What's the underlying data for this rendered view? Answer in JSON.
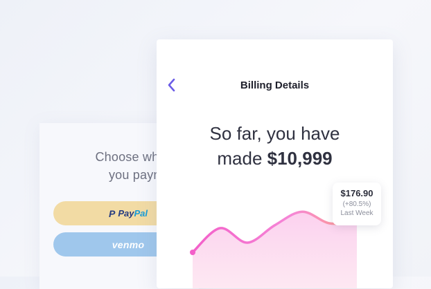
{
  "payment_card": {
    "headline_line1": "Choose where to",
    "headline_line2": "you paymen",
    "options": [
      {
        "pp_mark": "P",
        "pay": "Pay",
        "pal": "Pal",
        "color": "#f2dba4"
      },
      {
        "label": "venmo",
        "color": "#9fc7ec"
      }
    ]
  },
  "billing": {
    "back_icon": "chevron-left-icon",
    "title": "Billing Details",
    "summary_line1": "So far, you have",
    "summary_prefix": "made",
    "summary_amount": "$10,999",
    "accent_color": "#6b5ce7"
  },
  "tooltip": {
    "value": "$176.90",
    "change": "(+80.5%)",
    "period": "Last Week"
  },
  "chart_data": {
    "type": "area",
    "x": [
      0,
      1,
      2,
      3,
      4,
      5,
      6
    ],
    "y": [
      30,
      55,
      40,
      58,
      72,
      60,
      62
    ],
    "ylim": [
      0,
      100
    ],
    "xlabel": "",
    "ylabel": "",
    "grid": false,
    "line_gradient": [
      "#f35fc9",
      "#ff9f8a"
    ]
  }
}
